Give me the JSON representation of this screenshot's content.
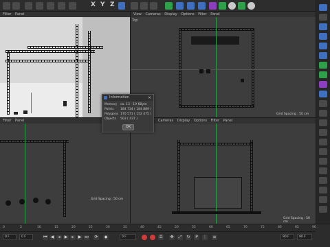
{
  "toolbar": {
    "axis_x": "X",
    "axis_y": "Y",
    "axis_z": "Z"
  },
  "viewports": {
    "perspective": {
      "menu": [
        "Filter",
        "Panel"
      ]
    },
    "top": {
      "menu": [
        "View",
        "Cameras",
        "Display",
        "Options",
        "Filter",
        "Panel"
      ],
      "label": "Top"
    },
    "left": {
      "menu": [
        "Filter",
        "Panel"
      ],
      "grid_spacing": "Grid Spacing : 50 cm"
    },
    "front": {
      "menu": [
        "Cameras",
        "Display",
        "Options",
        "Filter",
        "Panel"
      ],
      "grid_spacing": "Grid Spacing : 50 cm"
    },
    "top_grid_spacing": "Grid Spacing : 50 cm"
  },
  "info_dialog": {
    "title": "Information",
    "rows": [
      {
        "label": "Memory",
        "value": "ca. 13 - 19 KByte"
      },
      {
        "label": "Points",
        "value": "184 734 ( 184 889 )"
      },
      {
        "label": "Polygons",
        "value": "170 571 ( 152 475 )"
      },
      {
        "label": "Objects",
        "value": "503 ( 437 )"
      }
    ],
    "ok_label": "OK"
  },
  "timeline": {
    "ticks": [
      "0",
      "5",
      "10",
      "15",
      "20",
      "25",
      "30",
      "35",
      "40",
      "45",
      "50",
      "55",
      "60",
      "65",
      "70",
      "75",
      "80",
      "85",
      "90"
    ],
    "current_frame": "0 F",
    "start_frame": "0 F",
    "end_frame": "90 F",
    "preview_end": "90 F"
  },
  "colors": {
    "accent_blue": "#3f6fbf",
    "axis_green": "#2fa04a",
    "record_red": "#d23a3a"
  }
}
